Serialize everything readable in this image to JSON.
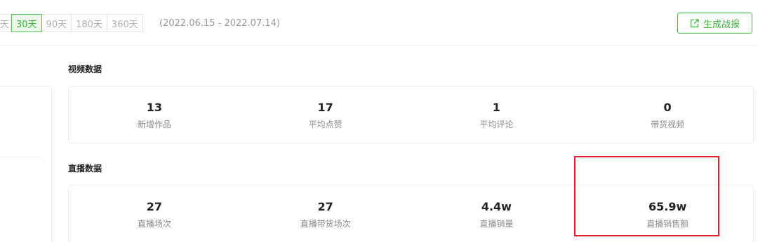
{
  "toolbar": {
    "ranges": [
      {
        "label": "天",
        "active": false
      },
      {
        "label": "30天",
        "active": true
      },
      {
        "label": "90天",
        "active": false
      },
      {
        "label": "180天",
        "active": false
      },
      {
        "label": "360天",
        "active": false
      }
    ],
    "date_range": "(2022.06.15 - 2022.07.14)",
    "report_button_label": "生成战报",
    "report_button_icon": "share-external-icon"
  },
  "video_section": {
    "title": "视频数据",
    "stats": [
      {
        "value": "13",
        "label": "新增作品"
      },
      {
        "value": "17",
        "label": "平均点赞"
      },
      {
        "value": "1",
        "label": "平均评论"
      },
      {
        "value": "0",
        "label": "带货视频"
      }
    ]
  },
  "live_section": {
    "title": "直播数据",
    "stats": [
      {
        "value": "27",
        "label": "直播场次"
      },
      {
        "value": "27",
        "label": "直播带货场次"
      },
      {
        "value": "4.4w",
        "label": "直播销量"
      },
      {
        "value": "65.9w",
        "label": "直播销售额"
      }
    ]
  },
  "colors": {
    "accent_green": "#3bb33b",
    "active_bg": "#e9f8e9",
    "highlight_red": "#e0202a"
  }
}
